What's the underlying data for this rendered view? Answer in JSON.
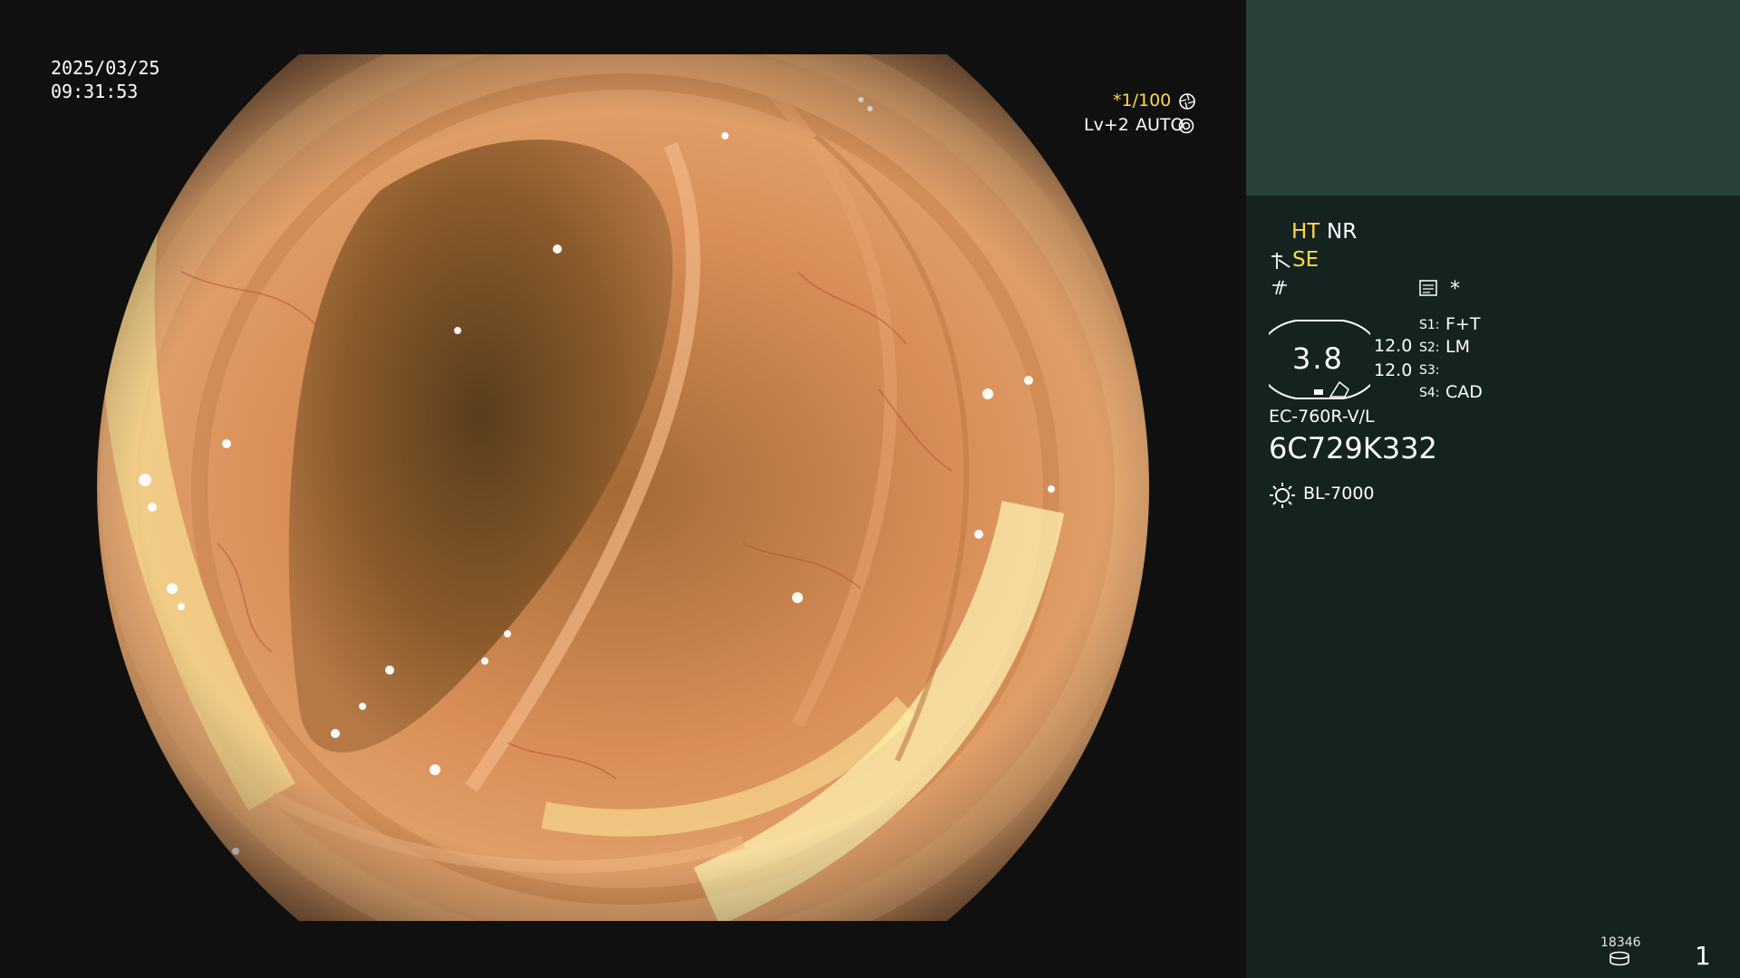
{
  "overlay": {
    "date": "2025/03/25",
    "time": "09:31:53",
    "shutter": "*1/100",
    "level": "Lv+2",
    "auto": "AUTO"
  },
  "info_panel": {
    "mode_ht": "HT",
    "mode_nr": "NR",
    "se": "SE",
    "asterisk": "*",
    "gauge_value": "3.8",
    "val_1": "12.0",
    "val_2": "12.0",
    "s1_label": "S1:",
    "s1_value": "F+T",
    "s2_label": "S2:",
    "s2_value": "LM",
    "s3_label": "S3:",
    "s3_value": "",
    "s4_label": "S4:",
    "s4_value": "CAD",
    "scope_model": "EC-760R-V/L",
    "serial": "6C729K332",
    "light_source": "BL-7000",
    "counter": "18346",
    "page_number": "1"
  },
  "colors": {
    "accent_yellow": "#ffd84a",
    "panel_dark": "#142320",
    "panel_top": "#29403b"
  },
  "icons": [
    "aperture-icon",
    "settings-icon",
    "scope-hand-icon",
    "freeze-icon",
    "image-settings-icon",
    "light-source-icon",
    "storage-icon"
  ]
}
